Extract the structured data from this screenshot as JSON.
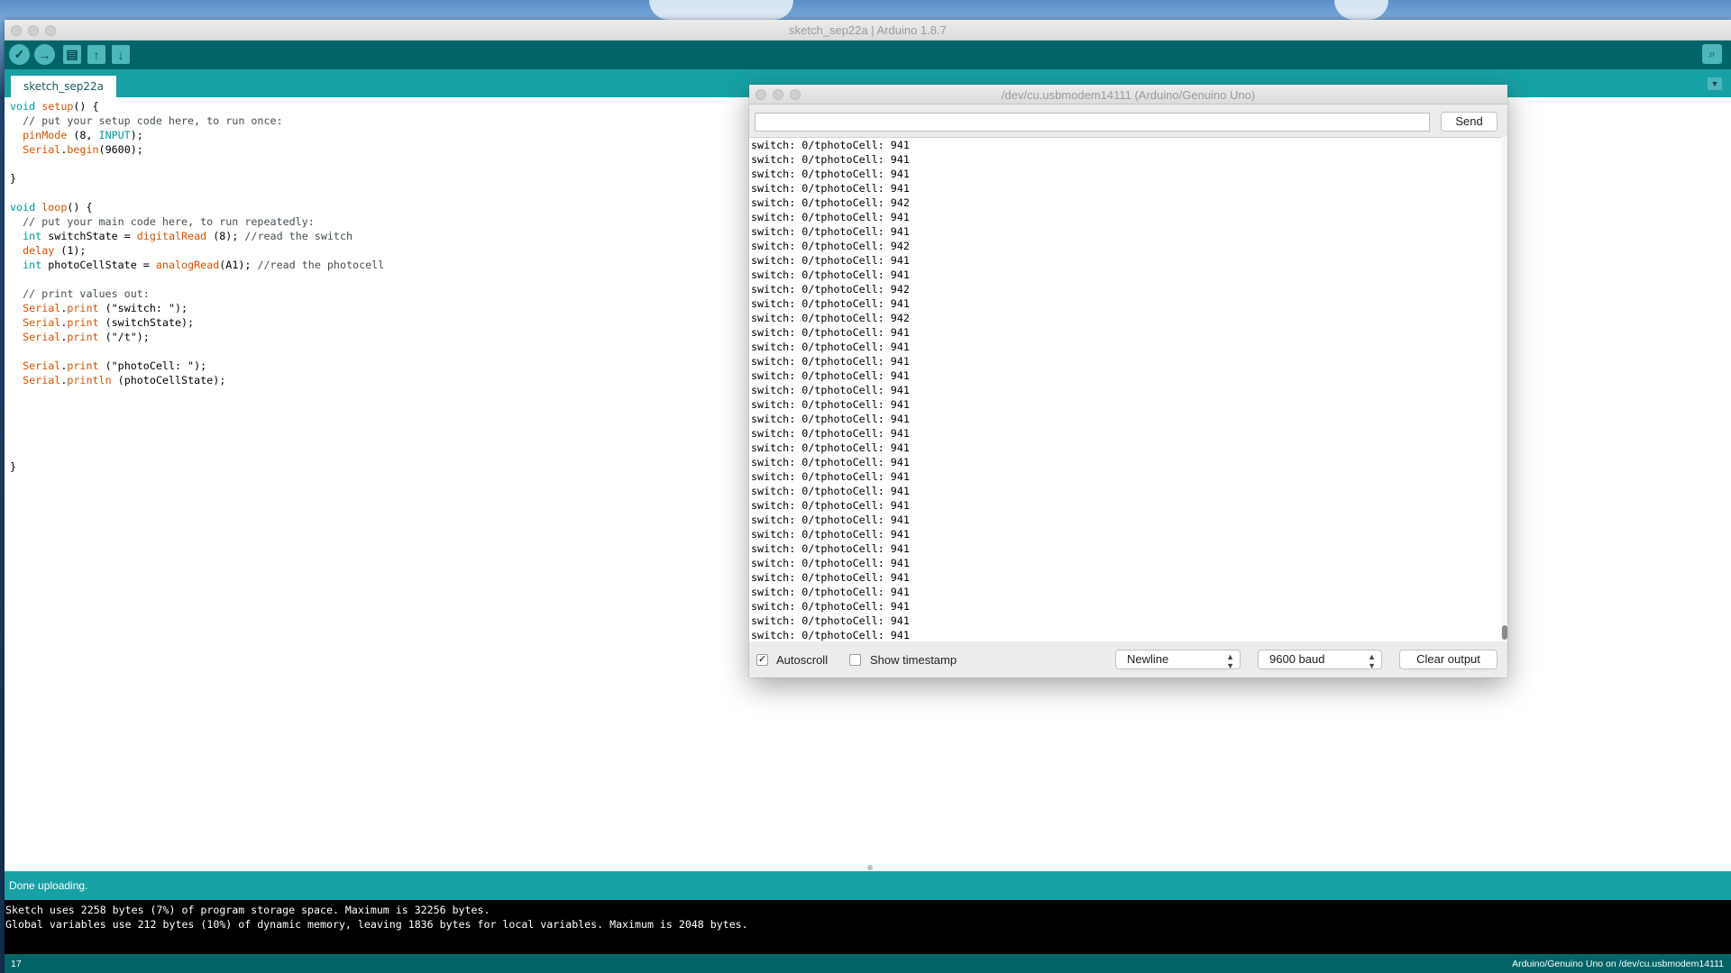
{
  "ide": {
    "window_title": "sketch_sep22a | Arduino 1.8.7",
    "tab_label": "sketch_sep22a",
    "toolbar": {
      "verify_icon": "✓",
      "upload_icon": "→",
      "new_icon": "▤",
      "open_icon": "↑",
      "save_icon": "↓",
      "serial_monitor_icon": "⌕"
    },
    "status_message": "Done uploading.",
    "console_lines": [
      "Sketch uses 2258 bytes (7%) of program storage space. Maximum is 32256 bytes.",
      "Global variables use 212 bytes (10%) of dynamic memory, leaving 1836 bytes for local variables. Maximum is 2048 bytes."
    ],
    "line_number": "17",
    "board_info": "Arduino/Genuino Uno on /dev/cu.usbmodem14111"
  },
  "code_lines": [
    [
      {
        "t": "void",
        "c": "kw"
      },
      {
        "t": " "
      },
      {
        "t": "setup",
        "c": "fn"
      },
      {
        "t": "() {"
      }
    ],
    [
      {
        "t": "  // put your setup code here, to run once:",
        "c": "cm"
      }
    ],
    [
      {
        "t": "  "
      },
      {
        "t": "pinMode",
        "c": "fn"
      },
      {
        "t": " (8, "
      },
      {
        "t": "INPUT",
        "c": "kw"
      },
      {
        "t": ");"
      }
    ],
    [
      {
        "t": "  "
      },
      {
        "t": "Serial",
        "c": "fn"
      },
      {
        "t": "."
      },
      {
        "t": "begin",
        "c": "fn"
      },
      {
        "t": "(9600);"
      }
    ],
    [
      {
        "t": ""
      }
    ],
    [
      {
        "t": "}"
      }
    ],
    [
      {
        "t": ""
      }
    ],
    [
      {
        "t": "void",
        "c": "kw"
      },
      {
        "t": " "
      },
      {
        "t": "loop",
        "c": "fn"
      },
      {
        "t": "() {"
      }
    ],
    [
      {
        "t": "  // put your main code here, to run repeatedly:",
        "c": "cm"
      }
    ],
    [
      {
        "t": "  "
      },
      {
        "t": "int",
        "c": "kw"
      },
      {
        "t": " switchState = "
      },
      {
        "t": "digitalRead",
        "c": "fn"
      },
      {
        "t": " (8); "
      },
      {
        "t": "//read the switch",
        "c": "cm"
      }
    ],
    [
      {
        "t": "  "
      },
      {
        "t": "delay",
        "c": "fn"
      },
      {
        "t": " (1);"
      }
    ],
    [
      {
        "t": "  "
      },
      {
        "t": "int",
        "c": "kw"
      },
      {
        "t": " photoCellState = "
      },
      {
        "t": "analogRead",
        "c": "fn"
      },
      {
        "t": "(A1); "
      },
      {
        "t": "//read the photocell",
        "c": "cm"
      }
    ],
    [
      {
        "t": ""
      }
    ],
    [
      {
        "t": "  // print values out:",
        "c": "cm"
      }
    ],
    [
      {
        "t": "  "
      },
      {
        "t": "Serial",
        "c": "fn"
      },
      {
        "t": "."
      },
      {
        "t": "print",
        "c": "fn"
      },
      {
        "t": " (\"switch: \");"
      }
    ],
    [
      {
        "t": "  "
      },
      {
        "t": "Serial",
        "c": "fn"
      },
      {
        "t": "."
      },
      {
        "t": "print",
        "c": "fn"
      },
      {
        "t": " (switchState);"
      }
    ],
    [
      {
        "t": "  "
      },
      {
        "t": "Serial",
        "c": "fn"
      },
      {
        "t": "."
      },
      {
        "t": "print",
        "c": "fn"
      },
      {
        "t": " (\"/t\");"
      }
    ],
    [
      {
        "t": ""
      }
    ],
    [
      {
        "t": "  "
      },
      {
        "t": "Serial",
        "c": "fn"
      },
      {
        "t": "."
      },
      {
        "t": "print",
        "c": "fn"
      },
      {
        "t": " (\"photoCell: \");"
      }
    ],
    [
      {
        "t": "  "
      },
      {
        "t": "Serial",
        "c": "fn"
      },
      {
        "t": "."
      },
      {
        "t": "println",
        "c": "fn"
      },
      {
        "t": " (photoCellState);"
      }
    ],
    [
      {
        "t": ""
      }
    ],
    [
      {
        "t": ""
      }
    ],
    [
      {
        "t": ""
      }
    ],
    [
      {
        "t": ""
      }
    ],
    [
      {
        "t": ""
      }
    ],
    [
      {
        "t": "}"
      }
    ]
  ],
  "serial_monitor": {
    "window_title": "/dev/cu.usbmodem14111 (Arduino/Genuino Uno)",
    "input_value": "",
    "send_label": "Send",
    "output_lines": [
      "switch: 0/tphotoCell: 941",
      "switch: 0/tphotoCell: 941",
      "switch: 0/tphotoCell: 941",
      "switch: 0/tphotoCell: 941",
      "switch: 0/tphotoCell: 942",
      "switch: 0/tphotoCell: 941",
      "switch: 0/tphotoCell: 941",
      "switch: 0/tphotoCell: 942",
      "switch: 0/tphotoCell: 941",
      "switch: 0/tphotoCell: 941",
      "switch: 0/tphotoCell: 942",
      "switch: 0/tphotoCell: 941",
      "switch: 0/tphotoCell: 942",
      "switch: 0/tphotoCell: 941",
      "switch: 0/tphotoCell: 941",
      "switch: 0/tphotoCell: 941",
      "switch: 0/tphotoCell: 941",
      "switch: 0/tphotoCell: 941",
      "switch: 0/tphotoCell: 941",
      "switch: 0/tphotoCell: 941",
      "switch: 0/tphotoCell: 941",
      "switch: 0/tphotoCell: 941",
      "switch: 0/tphotoCell: 941",
      "switch: 0/tphotoCell: 941",
      "switch: 0/tphotoCell: 941",
      "switch: 0/tphotoCell: 941",
      "switch: 0/tphotoCell: 941",
      "switch: 0/tphotoCell: 941",
      "switch: 0/tphotoCell: 941",
      "switch: 0/tphotoCell: 941",
      "switch: 0/tphotoCell: 941",
      "switch: 0/tphotoCell: 941",
      "switch: 0/tphotoCell: 941",
      "switch: 0/tphotoCell: 941",
      "switch: 0/tphotoCell: 941",
      "switch: 0/tphotoCell: 94"
    ],
    "autoscroll_label": "Autoscroll",
    "autoscroll_checked": true,
    "autoscroll_mark": "✓",
    "timestamp_label": "Show timestamp",
    "timestamp_checked": false,
    "line_ending": "Newline",
    "baud_rate": "9600 baud",
    "clear_label": "Clear output",
    "select_arrows": "▲▼"
  },
  "colors": {
    "toolbar": "#006468",
    "tabbar": "#17a1a5",
    "keyword": "#00979c",
    "function": "#d35400",
    "comment": "#434f54"
  }
}
